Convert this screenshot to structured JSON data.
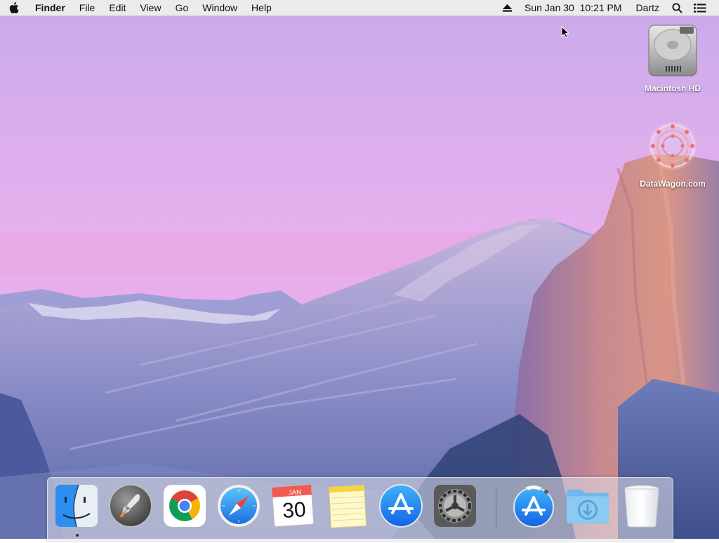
{
  "menubar": {
    "app_name": "Finder",
    "menus": [
      "File",
      "Edit",
      "View",
      "Go",
      "Window",
      "Help"
    ],
    "clock": "Sun Jan 30  10:21 PM",
    "user": "Dartz",
    "icons": [
      "apple-logo-icon",
      "eject-icon",
      "spotlight-search-icon",
      "notification-center-icon"
    ]
  },
  "desktop": {
    "items": [
      {
        "label": "Macintosh HD",
        "icon": "hard-drive-icon"
      },
      {
        "label": "DataWagon.com",
        "icon": "datawagon-logo-icon"
      }
    ]
  },
  "dock": {
    "items": [
      {
        "name": "Finder",
        "icon": "finder-icon",
        "running": true
      },
      {
        "name": "Launchpad",
        "icon": "launchpad-icon"
      },
      {
        "name": "Google Chrome",
        "icon": "chrome-icon"
      },
      {
        "name": "Safari",
        "icon": "safari-icon"
      },
      {
        "name": "Calendar",
        "icon": "calendar-icon",
        "month": "JAN",
        "day": "30"
      },
      {
        "name": "Notes",
        "icon": "notes-icon"
      },
      {
        "name": "App Store",
        "icon": "app-store-icon"
      },
      {
        "name": "System Preferences",
        "icon": "system-preferences-icon"
      },
      {
        "name": "App Store installer",
        "icon": "app-store-installer-icon"
      },
      {
        "name": "Downloads",
        "icon": "downloads-folder-icon"
      },
      {
        "name": "Trash",
        "icon": "trash-icon"
      }
    ]
  }
}
